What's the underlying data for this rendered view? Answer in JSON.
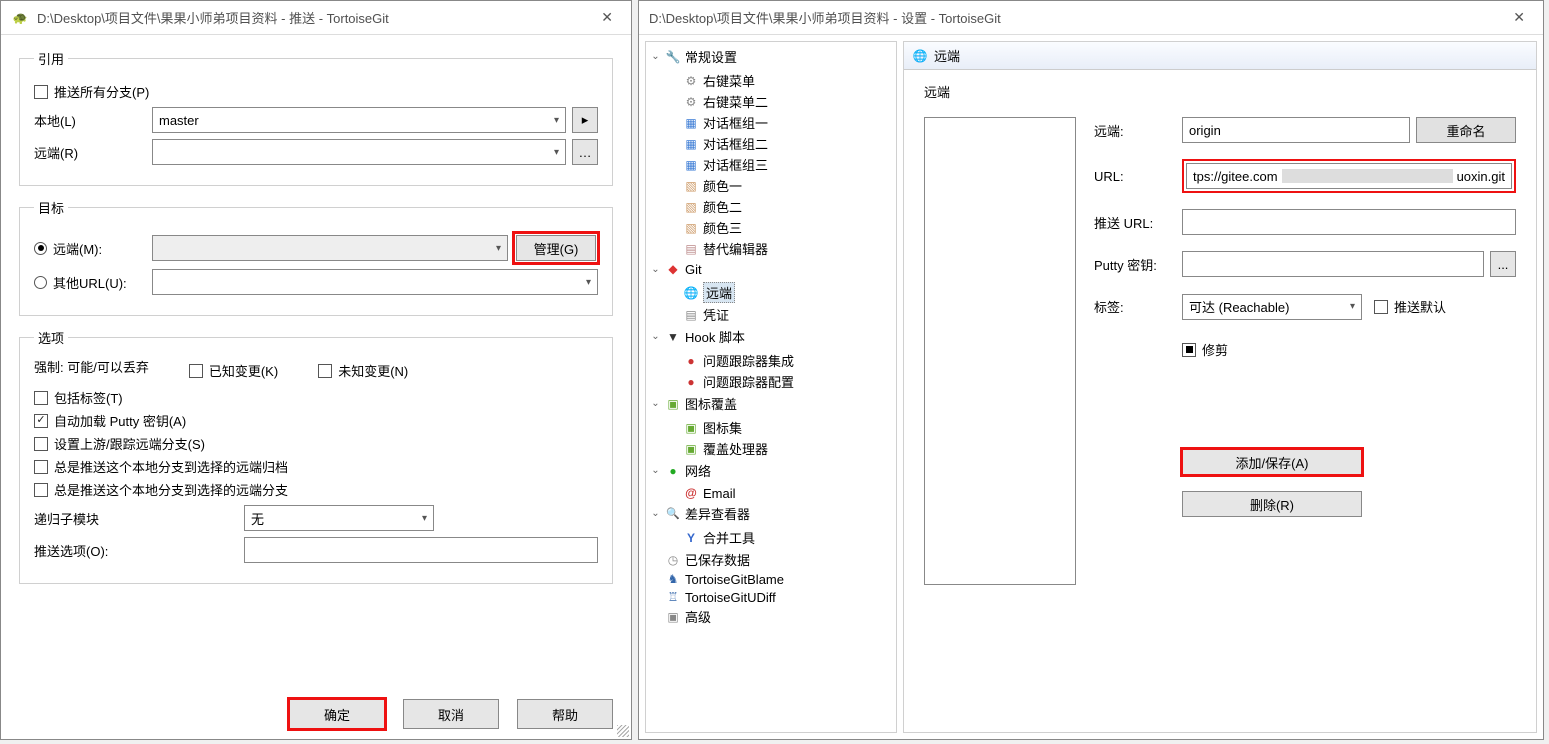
{
  "left": {
    "title": "D:\\Desktop\\项目文件\\果果小师弟项目资料 - 推送 - TortoiseGit",
    "ref_section": "引用",
    "push_all": "推送所有分支(P)",
    "local_label": "本地(L)",
    "local_value": "master",
    "remote_label": "远端(R)",
    "target_section": "目标",
    "radio_remote": "远端(M):",
    "radio_url": "其他URL(U):",
    "manage_btn": "管理(G)",
    "options_section": "选项",
    "force_label": "强制:  可能/可以丢弃",
    "known_changes": "已知变更(K)",
    "unknown_changes": "未知变更(N)",
    "include_tags": "包括标签(T)",
    "autoload_putty": "自动加载 Putty 密钥(A)",
    "set_upstream": "设置上游/跟踪远端分支(S)",
    "always_push_archive": "总是推送这个本地分支到选择的远端归档",
    "always_push_branch": "总是推送这个本地分支到选择的远端分支",
    "recurse_label": "递归子模块",
    "recurse_value": "无",
    "push_opt_label": "推送选项(O):",
    "ok_btn": "确定",
    "cancel_btn": "取消",
    "help_btn": "帮助"
  },
  "right": {
    "title": "D:\\Desktop\\项目文件\\果果小师弟项目资料 - 设置 - TortoiseGit",
    "detail_title": "远端",
    "section_title": "远端",
    "tree": {
      "general": "常规设置",
      "context1": "右键菜单",
      "context2": "右键菜单二",
      "dialog1": "对话框组一",
      "dialog2": "对话框组二",
      "dialog3": "对话框组三",
      "color1": "颜色一",
      "color2": "颜色二",
      "color3": "颜色三",
      "alt_editor": "替代编辑器",
      "git": "Git",
      "remote": "远端",
      "cred": "凭证",
      "hook": "Hook 脚本",
      "issue_int": "问题跟踪器集成",
      "issue_cfg": "问题跟踪器配置",
      "overlay": "图标覆盖",
      "iconset": "图标集",
      "overlay_h": "覆盖处理器",
      "network": "网络",
      "email": "Email",
      "diff": "差异查看器",
      "merge": "合并工具",
      "saved": "已保存数据",
      "blame": "TortoiseGitBlame",
      "udiff": "TortoiseGitUDiff",
      "advanced": "高级"
    },
    "form": {
      "remote_label": "远端:",
      "remote_value": "origin",
      "rename_btn": "重命名",
      "url_label": "URL:",
      "url_value_left": "tps://gitee.com",
      "url_value_right": "uoxin.git",
      "push_url_label": "推送 URL:",
      "putty_label": "Putty 密钥:",
      "browse_btn": "...",
      "tag_label": "标签:",
      "tag_value": "可达 (Reachable)",
      "push_default": "推送默认",
      "prune": "修剪",
      "add_save_btn": "添加/保存(A)",
      "delete_btn": "删除(R)"
    }
  }
}
